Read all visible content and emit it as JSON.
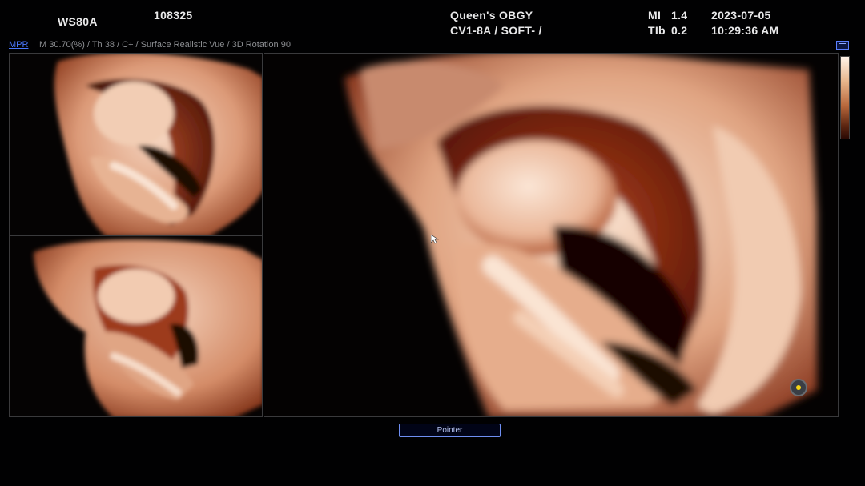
{
  "header": {
    "device": "WS80A",
    "patient_id": "108325",
    "institution": "Queen's OBGY",
    "probe_preset": "CV1-8A / SOFT- /",
    "mi_label": "MI",
    "mi_value": "1.4",
    "tib_label": "TIb",
    "tib_value": "0.2",
    "date": "2023-07-05",
    "time": "10:29:36 AM"
  },
  "info_bar": {
    "mode": "MPR",
    "params": "M 30.70(%) / Th 38 / C+ / Surface Realistic Vue / 3D Rotation 90"
  },
  "viewports": {
    "top_left": "3D surface render view A",
    "bottom_left": "3D surface render view B",
    "main": "3D surface render main view"
  },
  "controls": {
    "pointer_label": "Pointer"
  },
  "icons": {
    "menu": "menu-icon",
    "orientation": "orientation-marker-icon",
    "cursor": "mouse-cursor-icon"
  },
  "colors": {
    "tissue_light": "#f0c6aa",
    "tissue_mid": "#c76a44",
    "tissue_dark": "#7a200e",
    "accent_blue": "#4a78ff",
    "marker_yellow": "#f5d415"
  }
}
